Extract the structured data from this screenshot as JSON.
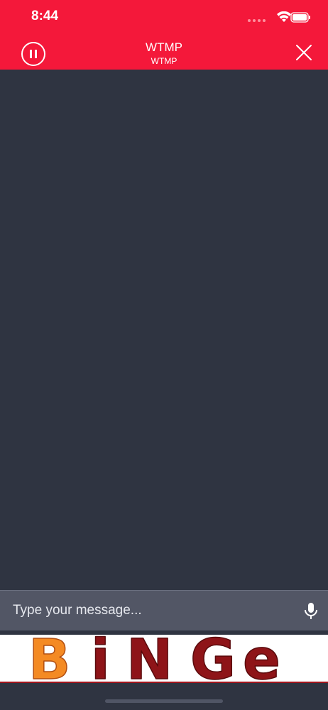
{
  "status": {
    "time": "8:44"
  },
  "header": {
    "title": "WTMP",
    "subtitle": "WTMP",
    "pause_icon": "pause-circle-icon",
    "close_icon": "close-icon",
    "background": "#f4183a"
  },
  "composer": {
    "placeholder": "Type your message...",
    "value": "",
    "mic_icon": "microphone-icon"
  },
  "banner": {
    "text": "BiNGE",
    "colors": {
      "accent": "#f48a23",
      "main": "#8e1418"
    }
  }
}
